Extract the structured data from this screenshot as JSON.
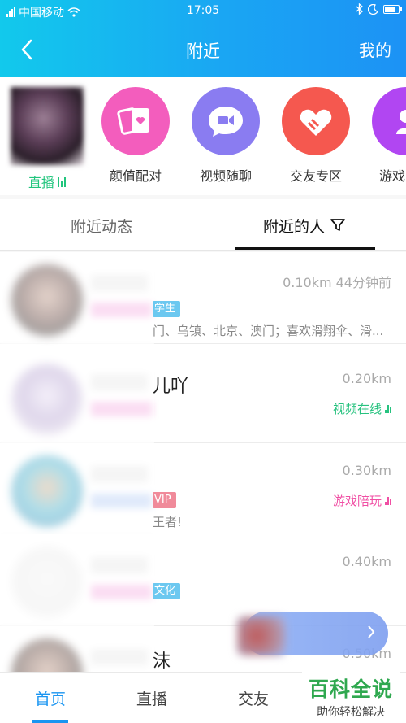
{
  "status_bar": {
    "carrier": "中国移动",
    "time": "17:05"
  },
  "nav": {
    "title": "附近",
    "right": "我的"
  },
  "categories": [
    {
      "label": "直播",
      "icon": "live-bars-icon",
      "color": "#21c57d"
    },
    {
      "label": "颜值配对",
      "icon": "card-heart-icon",
      "color": "#f35dbd"
    },
    {
      "label": "视频随聊",
      "icon": "video-chat-icon",
      "color": "#8a7cf1"
    },
    {
      "label": "交友专区",
      "icon": "hearts-icon",
      "color": "#f5584f"
    },
    {
      "label": "游戏",
      "icon": "game-icon",
      "color": "#b146f2"
    }
  ],
  "tabs": [
    {
      "label": "附近动态",
      "active": false
    },
    {
      "label": "附近的人",
      "active": true,
      "icon": "filter-icon"
    }
  ],
  "people": [
    {
      "name_tail": "",
      "distance": "0.10km 44分钟前",
      "tag": "学生",
      "tag_color": "#6cc8f0",
      "bio": "门、乌镇、北京、澳门；喜欢滑翔伞、滑...",
      "status": "",
      "status_color": ""
    },
    {
      "name_tail": "儿吖",
      "distance": "0.20km",
      "tag": "",
      "tag_color": "",
      "bio": "",
      "status": "视频在线",
      "status_color": "#27c27f"
    },
    {
      "name_tail": "",
      "distance": "0.30km",
      "tag": "VIP",
      "tag_color": "#f08a9a",
      "bio": "王者!",
      "status": "游戏陪玩",
      "status_color": "#f04fa4"
    },
    {
      "name_tail": "",
      "distance": "0.40km",
      "tag": "文化",
      "tag_color": "#6cc8f0",
      "bio": "",
      "status": "",
      "status_color": ""
    },
    {
      "name_tail": "沫",
      "distance": "0.50km",
      "tag": "",
      "tag_color": "",
      "bio": "",
      "status": "",
      "status_color": ""
    }
  ],
  "bottom_nav": [
    {
      "label": "首页",
      "active": true
    },
    {
      "label": "直播",
      "active": false
    },
    {
      "label": "交友",
      "active": false
    }
  ],
  "watermark": {
    "title": "百科全说",
    "subtitle": "助你轻松解决"
  },
  "colors": {
    "header_start": "#12c9ec",
    "header_end": "#1c92f5",
    "accent_blue": "#1a95f1"
  }
}
